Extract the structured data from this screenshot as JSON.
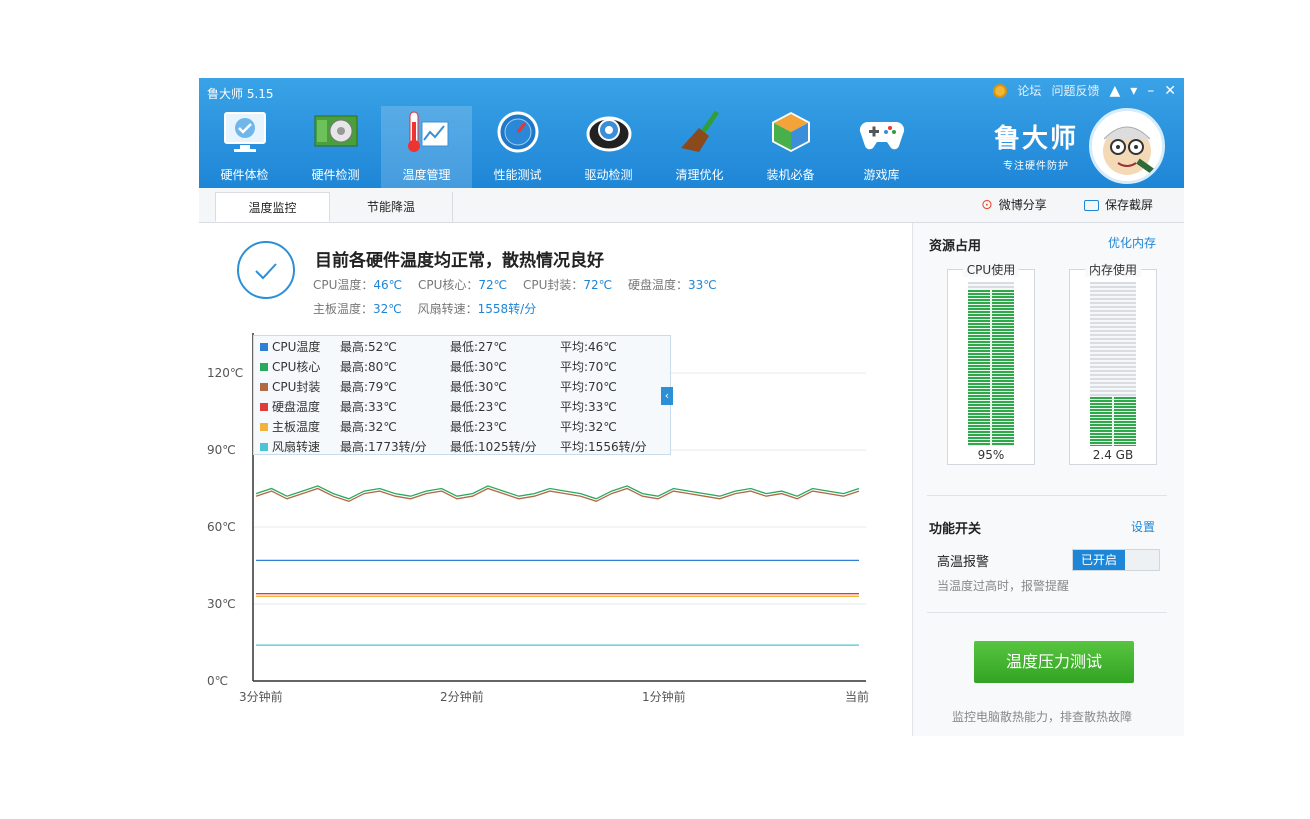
{
  "app": {
    "title": "鲁大师 5.15",
    "top_links": [
      "论坛",
      "问题反馈"
    ],
    "brand_name": "鲁大师",
    "brand_slogan": "专注硬件防护"
  },
  "nav": [
    {
      "label": "硬件体检",
      "icon": "monitor-check-icon"
    },
    {
      "label": "硬件检测",
      "icon": "graphics-card-icon"
    },
    {
      "label": "温度管理",
      "icon": "thermometer-chart-icon",
      "active": true
    },
    {
      "label": "性能测试",
      "icon": "speedometer-icon"
    },
    {
      "label": "驱动检测",
      "icon": "driver-gear-icon"
    },
    {
      "label": "清理优化",
      "icon": "broom-icon"
    },
    {
      "label": "装机必备",
      "icon": "cube-icon"
    },
    {
      "label": "游戏库",
      "icon": "gamepad-icon"
    }
  ],
  "tabs": [
    "温度监控",
    "节能降温"
  ],
  "share": {
    "weibo": "微博分享",
    "screenshot": "保存截屏"
  },
  "status": {
    "headline": "目前各硬件温度均正常，散热情况良好",
    "line1": [
      {
        "label": "CPU温度：",
        "value": "46℃"
      },
      {
        "label": "CPU核心：",
        "value": "72℃"
      },
      {
        "label": "CPU封装：",
        "value": "72℃"
      },
      {
        "label": "硬盘温度：",
        "value": "33℃"
      }
    ],
    "line2": [
      {
        "label": "主板温度：",
        "value": "32℃"
      },
      {
        "label": "风扇转速：",
        "value": "1558转/分"
      }
    ]
  },
  "legend": [
    {
      "name": "CPU温度",
      "color": "#2f7fd5",
      "max": "最高:52℃",
      "min": "最低:27℃",
      "avg": "平均:46℃"
    },
    {
      "name": "CPU核心",
      "color": "#2aa860",
      "max": "最高:80℃",
      "min": "最低:30℃",
      "avg": "平均:70℃"
    },
    {
      "name": "CPU封装",
      "color": "#b06a45",
      "max": "最高:79℃",
      "min": "最低:30℃",
      "avg": "平均:70℃"
    },
    {
      "name": "硬盘温度",
      "color": "#e03c3c",
      "max": "最高:33℃",
      "min": "最低:23℃",
      "avg": "平均:33℃"
    },
    {
      "name": "主板温度",
      "color": "#f0b43c",
      "max": "最高:32℃",
      "min": "最低:23℃",
      "avg": "平均:32℃"
    },
    {
      "name": "风扇转速",
      "color": "#4fc3d6",
      "max": "最高:1773转/分",
      "min": "最低:1025转/分",
      "avg": "平均:1556转/分"
    }
  ],
  "chart_data": {
    "type": "line",
    "ylim": [
      0,
      120
    ],
    "y_ticks": [
      "120℃",
      "90℃",
      "60℃",
      "30℃",
      "0℃"
    ],
    "x_ticks": [
      "3分钟前",
      "2分钟前",
      "1分钟前",
      "当前"
    ],
    "series": [
      {
        "name": "CPU核心",
        "color": "#2aa860",
        "values": [
          73,
          75,
          72,
          74,
          76,
          73,
          71,
          74,
          75,
          73,
          72,
          74,
          75,
          72,
          73,
          76,
          74,
          72,
          73,
          75,
          74,
          73,
          71,
          74,
          76,
          73,
          72,
          75,
          74,
          73,
          72,
          74,
          75,
          73,
          74,
          72,
          75,
          74,
          73,
          75
        ]
      },
      {
        "name": "CPU封装",
        "color": "#b06a45",
        "values": [
          72,
          74,
          71,
          73,
          75,
          72,
          70,
          73,
          74,
          72,
          71,
          73,
          74,
          71,
          72,
          75,
          73,
          71,
          72,
          74,
          73,
          72,
          70,
          73,
          75,
          72,
          71,
          74,
          73,
          72,
          71,
          73,
          74,
          72,
          73,
          71,
          74,
          73,
          72,
          74
        ]
      },
      {
        "name": "CPU温度",
        "color": "#2f7fd5",
        "values": [
          47,
          47,
          47,
          47,
          47,
          47,
          47,
          47,
          47,
          47,
          47,
          47,
          47,
          47,
          47,
          47,
          47,
          47,
          47,
          47,
          47,
          47,
          47,
          47,
          47,
          47,
          47,
          47,
          47,
          47,
          47,
          47,
          47,
          47,
          47,
          47,
          47,
          47,
          47,
          47
        ]
      },
      {
        "name": "硬盘温度",
        "color": "#e03c3c",
        "values": [
          34,
          34,
          34,
          34,
          34,
          34,
          34,
          34,
          34,
          34,
          34,
          34,
          34,
          34,
          34,
          34,
          34,
          34,
          34,
          34,
          34,
          34,
          34,
          34,
          34,
          34,
          34,
          34,
          34,
          34,
          34,
          34,
          34,
          34,
          34,
          34,
          34,
          34,
          34,
          34
        ]
      },
      {
        "name": "主板温度",
        "color": "#f0b43c",
        "values": [
          33,
          33,
          33,
          33,
          33,
          33,
          33,
          33,
          33,
          33,
          33,
          33,
          33,
          33,
          33,
          33,
          33,
          33,
          33,
          33,
          33,
          33,
          33,
          33,
          33,
          33,
          33,
          33,
          33,
          33,
          33,
          33,
          33,
          33,
          33,
          33,
          33,
          33,
          33,
          33
        ]
      },
      {
        "name": "风扇转速",
        "color": "#4fc3d6",
        "values": [
          14,
          14,
          14,
          14,
          14,
          14,
          14,
          14,
          14,
          14,
          14,
          14,
          14,
          14,
          14,
          14,
          14,
          14,
          14,
          14,
          14,
          14,
          14,
          14,
          14,
          14,
          14,
          14,
          14,
          14,
          14,
          14,
          14,
          14,
          14,
          14,
          14,
          14,
          14,
          14
        ]
      }
    ]
  },
  "resources": {
    "title": "资源占用",
    "optimize_link": "优化内存",
    "cpu": {
      "title": "CPU使用",
      "value": "95%",
      "fraction": 0.95
    },
    "mem": {
      "title": "内存使用",
      "value": "2.4 GB",
      "fraction": 0.3
    }
  },
  "functions": {
    "title": "功能开关",
    "settings_link": "设置",
    "alarm_label": "高温报警",
    "alarm_state": "已开启",
    "alarm_hint": "当温度过高时，报警提醒"
  },
  "stress_test": {
    "button": "温度压力测试",
    "hint": "监控电脑散热能力，排查散热故障"
  }
}
